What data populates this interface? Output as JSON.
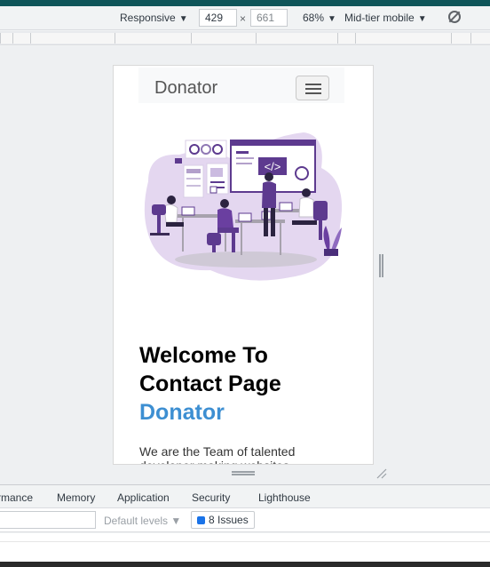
{
  "toolbar": {
    "device": "Responsive",
    "width": "429",
    "height": "661",
    "times": "×",
    "zoom": "68%",
    "throttle": "Mid-tier mobile",
    "dropdown_glyph": "▼"
  },
  "page": {
    "brand": "Donator",
    "headline_line1": "Welcome To",
    "headline_line2": "Contact Page",
    "headline_accent": "Donator",
    "paragraph": "We are the Team of talented developer making websites"
  },
  "devtools": {
    "tabs": [
      "rmance",
      "Memory",
      "Application",
      "Security",
      "Lighthouse"
    ],
    "levels": "Default levels ▼",
    "issues": "8 Issues"
  },
  "colors": {
    "accent": "#3d8fd2",
    "illustration_purple": "#6a3fa0",
    "illustration_lavender": "#d9c8ea",
    "devtools_top": "#0f5559",
    "issue_blue": "#1a73e8"
  },
  "icons": [
    "rotate-icon",
    "hamburger-icon",
    "resize-corner-icon",
    "issue-icon",
    "illustration-image"
  ]
}
